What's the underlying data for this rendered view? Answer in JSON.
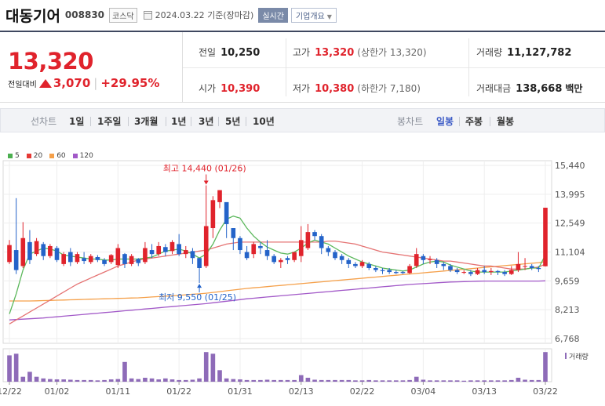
{
  "header": {
    "name": "대동기어",
    "code": "008830",
    "market": "코스닥",
    "date": "2024.03.22 기준(장마감)",
    "realtime_btn": "실시간",
    "info_btn": "기업개요"
  },
  "summary": {
    "price": "13,320",
    "change_label": "전일대비",
    "change_value": "3,070",
    "change_pct": "+29.95%",
    "prev_close_label": "전일",
    "prev_close": "10,250",
    "open_label": "시가",
    "open": "10,390",
    "high_label": "고가",
    "high": "13,320",
    "upper_limit": "(상한가 13,320)",
    "low_label": "저가",
    "low": "10,380",
    "lower_limit": "(하한가 7,180)",
    "volume_label": "거래량",
    "volume": "11,127,782",
    "amount_label": "거래대금",
    "amount": "138,668",
    "amount_unit": "백만"
  },
  "toolbar": {
    "line_chart": "선차트",
    "periods": [
      "1일",
      "1주일",
      "3개월",
      "1년",
      "3년",
      "5년",
      "10년"
    ],
    "candle_chart": "봉차트",
    "candle_periods": [
      "일봉",
      "주봉",
      "월봉"
    ],
    "candle_selected": 0
  },
  "legend": [
    {
      "label": "5",
      "color": "#4caf50"
    },
    {
      "label": "20",
      "color": "#e53935"
    },
    {
      "label": "60",
      "color": "#f5a04a"
    },
    {
      "label": "120",
      "color": "#a259c8"
    }
  ],
  "chart_data": {
    "type": "candlestick",
    "y_ticks": [
      15440,
      13995,
      12549,
      11104,
      9659,
      8213,
      6768
    ],
    "ylim": [
      6768,
      15440
    ],
    "x_tick_labels": [
      "12/22",
      "01/02",
      "01/11",
      "01/22",
      "01/31",
      "02/13",
      "02/22",
      "03/04",
      "03/13",
      "03/22"
    ],
    "x_tick_index": [
      0,
      7,
      16,
      25,
      34,
      43,
      52,
      61,
      70,
      79
    ],
    "annotation_high": "최고 14,440 (01/26)",
    "annotation_low": "최저 9,550 (01/25)",
    "high_index": 29,
    "high_value": 14440,
    "low_index": 28,
    "low_value": 9550,
    "volume_label": "거래량",
    "up_color": "#e0232c",
    "down_color": "#2463c9",
    "candles": [
      [
        10600,
        11450,
        10500,
        11700
      ],
      [
        11200,
        10200,
        10000,
        13800
      ],
      [
        10400,
        11800,
        10300,
        12600
      ],
      [
        11600,
        10700,
        10500,
        12200
      ],
      [
        11000,
        11650,
        10900,
        11800
      ],
      [
        11500,
        10900,
        10700,
        11600
      ],
      [
        10900,
        11400,
        10800,
        11500
      ],
      [
        11300,
        10700,
        10600,
        11400
      ],
      [
        10500,
        11000,
        10400,
        11100
      ],
      [
        11100,
        10600,
        10400,
        11300
      ],
      [
        10600,
        11000,
        10500,
        11100
      ],
      [
        10800,
        10650,
        10500,
        11100
      ],
      [
        10600,
        10900,
        10500,
        11000
      ],
      [
        10850,
        10700,
        10600,
        10950
      ],
      [
        10700,
        10500,
        10400,
        10800
      ],
      [
        10600,
        10950,
        10500,
        11000
      ],
      [
        10450,
        11300,
        10300,
        11500
      ],
      [
        11000,
        10500,
        10300,
        11050
      ],
      [
        10500,
        10900,
        10400,
        11000
      ],
      [
        10750,
        10550,
        10400,
        10800
      ],
      [
        10600,
        11300,
        10500,
        11600
      ],
      [
        11200,
        11000,
        10800,
        11500
      ],
      [
        11000,
        11400,
        10900,
        11600
      ],
      [
        11350,
        11100,
        10900,
        11500
      ],
      [
        11150,
        11600,
        11000,
        11700
      ],
      [
        11500,
        11000,
        10900,
        12000
      ],
      [
        11000,
        11200,
        10800,
        11400
      ],
      [
        11150,
        10800,
        10500,
        11300
      ],
      [
        10800,
        10300,
        9550,
        10800
      ],
      [
        10400,
        12400,
        10300,
        14440
      ],
      [
        12300,
        13700,
        11800,
        13900
      ],
      [
        13600,
        14200,
        13300,
        14200
      ],
      [
        13600,
        12500,
        11800,
        13500
      ],
      [
        12300,
        11800,
        11200,
        12300
      ],
      [
        11800,
        11200,
        11000,
        11900
      ],
      [
        11100,
        10800,
        10700,
        11400
      ],
      [
        11000,
        11500,
        10800,
        11600
      ],
      [
        11400,
        11300,
        11000,
        11600
      ],
      [
        11200,
        10900,
        10700,
        11700
      ],
      [
        10900,
        10600,
        10500,
        11000
      ],
      [
        10600,
        10700,
        10300,
        10800
      ],
      [
        10800,
        10700,
        10500,
        10900
      ],
      [
        10700,
        11100,
        10600,
        11100
      ],
      [
        10900,
        11700,
        10600,
        12400
      ],
      [
        11300,
        12100,
        11200,
        12500
      ],
      [
        12100,
        11900,
        11700,
        12200
      ],
      [
        11900,
        11300,
        11000,
        12000
      ],
      [
        11300,
        11100,
        10900,
        11400
      ],
      [
        11100,
        10800,
        10700,
        11200
      ],
      [
        10900,
        10700,
        10500,
        11000
      ],
      [
        10700,
        10500,
        10300,
        10800
      ],
      [
        10500,
        10400,
        10300,
        10600
      ],
      [
        10400,
        10600,
        10300,
        10700
      ],
      [
        10500,
        10300,
        10200,
        10600
      ],
      [
        10300,
        10200,
        10100,
        10400
      ],
      [
        10200,
        10150,
        10000,
        10300
      ],
      [
        10200,
        10100,
        10000,
        10300
      ],
      [
        10100,
        10050,
        10000,
        10200
      ],
      [
        10100,
        10050,
        10000,
        10150
      ],
      [
        10050,
        10400,
        10000,
        10500
      ],
      [
        10400,
        11000,
        10300,
        11300
      ],
      [
        10900,
        10700,
        10500,
        11000
      ],
      [
        10700,
        10750,
        10500,
        10900
      ],
      [
        10700,
        10500,
        10300,
        10800
      ],
      [
        10500,
        10400,
        10200,
        10600
      ],
      [
        10400,
        10200,
        10100,
        10500
      ],
      [
        10200,
        10100,
        10000,
        10300
      ],
      [
        10100,
        10100,
        10000,
        10200
      ],
      [
        10100,
        10000,
        9900,
        10200
      ],
      [
        10000,
        10200,
        9950,
        10300
      ],
      [
        10200,
        10100,
        10000,
        10400
      ],
      [
        10100,
        10150,
        9950,
        10300
      ],
      [
        10150,
        10100,
        9950,
        10200
      ],
      [
        10100,
        10000,
        9900,
        10200
      ],
      [
        10000,
        10200,
        9950,
        10400
      ],
      [
        10200,
        10500,
        10100,
        11100
      ],
      [
        10400,
        10400,
        10200,
        10800
      ],
      [
        10400,
        10300,
        10200,
        10500
      ],
      [
        10300,
        10250,
        10100,
        10400
      ],
      [
        10390,
        13320,
        10380,
        13320
      ]
    ],
    "volumes": [
      0.8,
      0.85,
      0.15,
      0.3,
      0.15,
      0.1,
      0.08,
      0.07,
      0.07,
      0.06,
      0.05,
      0.05,
      0.05,
      0.04,
      0.05,
      0.07,
      0.08,
      0.6,
      0.1,
      0.08,
      0.12,
      0.1,
      0.07,
      0.1,
      0.07,
      0.05,
      0.05,
      0.06,
      0.1,
      0.9,
      0.85,
      0.35,
      0.1,
      0.08,
      0.07,
      0.05,
      0.05,
      0.05,
      0.06,
      0.05,
      0.05,
      0.05,
      0.05,
      0.2,
      0.12,
      0.06,
      0.05,
      0.05,
      0.05,
      0.05,
      0.05,
      0.04,
      0.04,
      0.05,
      0.04,
      0.04,
      0.04,
      0.04,
      0.04,
      0.05,
      0.15,
      0.06,
      0.04,
      0.04,
      0.04,
      0.04,
      0.04,
      0.03,
      0.04,
      0.04,
      0.04,
      0.04,
      0.04,
      0.04,
      0.05,
      0.12,
      0.06,
      0.05,
      0.05,
      0.9
    ],
    "ma5": [
      8000,
      9000,
      10200,
      11000,
      11150,
      11300,
      11250,
      11150,
      10950,
      10900,
      10850,
      10800,
      10750,
      10750,
      10700,
      10700,
      10750,
      10750,
      10750,
      10750,
      10800,
      10850,
      11000,
      11150,
      11200,
      11250,
      11150,
      11000,
      10800,
      11000,
      11500,
      12200,
      12750,
      12900,
      12800,
      12300,
      11900,
      11600,
      11350,
      11200,
      11050,
      11000,
      11100,
      11300,
      11550,
      11700,
      11600,
      11500,
      11300,
      11100,
      10900,
      10750,
      10600,
      10500,
      10400,
      10300,
      10250,
      10200,
      10150,
      10200,
      10350,
      10500,
      10600,
      10650,
      10600,
      10450,
      10350,
      10250,
      10150,
      10100,
      10100,
      10100,
      10100,
      10100,
      10150,
      10200,
      10250,
      10300,
      10300,
      10950
    ],
    "ma20": [
      7500,
      7700,
      7900,
      8100,
      8300,
      8500,
      8700,
      8900,
      9100,
      9300,
      9500,
      9650,
      9800,
      9950,
      10100,
      10250,
      10400,
      10500,
      10600,
      10700,
      10750,
      10800,
      10850,
      10900,
      10950,
      11000,
      11050,
      11100,
      11150,
      11200,
      11300,
      11400,
      11500,
      11550,
      11600,
      11600,
      11600,
      11600,
      11600,
      11600,
      11600,
      11600,
      11600,
      11600,
      11600,
      11600,
      11600,
      11650,
      11650,
      11600,
      11550,
      11500,
      11400,
      11300,
      11200,
      11100,
      11050,
      11000,
      10950,
      10900,
      10850,
      10800,
      10750,
      10700,
      10650,
      10650,
      10600,
      10550,
      10500,
      10450,
      10400,
      10400,
      10350,
      10300,
      10250,
      10250,
      10250,
      10300,
      10350,
      10500
    ],
    "ma60": [
      8650,
      8650,
      8650,
      8650,
      8660,
      8670,
      8680,
      8690,
      8700,
      8710,
      8720,
      8730,
      8740,
      8750,
      8760,
      8770,
      8780,
      8790,
      8800,
      8810,
      8830,
      8850,
      8870,
      8890,
      8910,
      8930,
      8960,
      8990,
      9010,
      9040,
      9080,
      9120,
      9160,
      9200,
      9240,
      9280,
      9310,
      9340,
      9370,
      9400,
      9430,
      9460,
      9490,
      9520,
      9550,
      9580,
      9610,
      9640,
      9670,
      9700,
      9730,
      9760,
      9790,
      9820,
      9850,
      9880,
      9910,
      9940,
      9970,
      10000,
      10030,
      10060,
      10090,
      10120,
      10150,
      10180,
      10210,
      10240,
      10270,
      10300,
      10330,
      10360,
      10390,
      10420,
      10450,
      10480,
      10510,
      10540,
      10570,
      10620
    ],
    "ma120": [
      7700,
      7720,
      7740,
      7760,
      7780,
      7800,
      7830,
      7860,
      7890,
      7920,
      7950,
      7980,
      8010,
      8040,
      8070,
      8100,
      8130,
      8160,
      8190,
      8220,
      8250,
      8280,
      8310,
      8340,
      8370,
      8400,
      8430,
      8460,
      8490,
      8520,
      8560,
      8600,
      8640,
      8680,
      8720,
      8760,
      8790,
      8820,
      8850,
      8880,
      8910,
      8940,
      8970,
      9000,
      9030,
      9060,
      9090,
      9120,
      9150,
      9180,
      9210,
      9240,
      9270,
      9300,
      9330,
      9360,
      9390,
      9420,
      9450,
      9480,
      9500,
      9520,
      9540,
      9560,
      9580,
      9600,
      9610,
      9620,
      9630,
      9640,
      9650,
      9650,
      9650,
      9650,
      9650,
      9650,
      9650,
      9650,
      9650,
      9660
    ]
  }
}
